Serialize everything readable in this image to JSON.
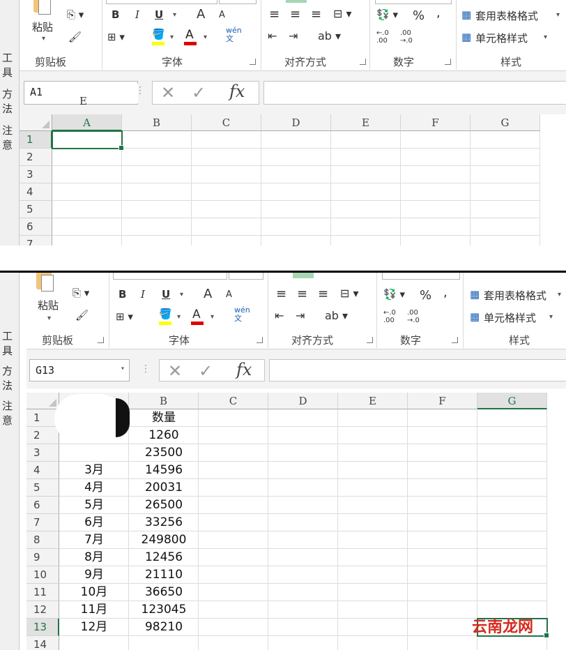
{
  "colors": {
    "accent": "#217346",
    "highlight_fill": "#ffff00",
    "font_color_bar": "#e00000",
    "watermark": "#d42b1e"
  },
  "left_strip_labels": [
    "工具",
    "方法",
    "注意"
  ],
  "ribbon": {
    "clipboard": {
      "paste_label": "粘贴",
      "group_label": "剪贴板",
      "icons": [
        "paste-icon",
        "copy-icon",
        "format-painter-icon"
      ]
    },
    "font": {
      "group_label": "字体",
      "bold": "B",
      "italic": "I",
      "underline": "U",
      "grow": "A",
      "shrink": "A",
      "phonetic": "wén\n文",
      "icons": [
        "border-icon",
        "fill-color-icon",
        "font-color-icon"
      ]
    },
    "alignment": {
      "group_label": "对齐方式",
      "icons": [
        "align-left-icon",
        "align-center-icon",
        "align-right-icon",
        "merge-icon",
        "indent-decrease-icon",
        "indent-increase-icon",
        "orientation-icon"
      ]
    },
    "number": {
      "group_label": "数字",
      "percent": "%",
      "comma": ",",
      "inc_decimal": "←.0\n.00",
      "dec_decimal": ".00\n→.0",
      "icons": [
        "accounting-icon"
      ]
    },
    "styles": {
      "group_label": "样式",
      "table_format": "套用表格格式",
      "cell_styles": "单元格样式"
    }
  },
  "top_panel": {
    "name_box": "A1",
    "formula_value": "",
    "tooltip_fragment": "E",
    "columns": [
      "A",
      "B",
      "C",
      "D",
      "E",
      "F",
      "G"
    ],
    "selected_column": "A",
    "rows": [
      "1",
      "2",
      "3",
      "4",
      "5",
      "6",
      "7"
    ],
    "selected_row": "1"
  },
  "bottom_panel": {
    "name_box": "G13",
    "formula_value": "",
    "columns": [
      "",
      "B",
      "C",
      "D",
      "E",
      "F",
      "G"
    ],
    "selected_column": "G",
    "rows": [
      "1",
      "2",
      "3",
      "4",
      "5",
      "6",
      "7",
      "8",
      "9",
      "10",
      "11",
      "12",
      "13",
      "14"
    ],
    "selected_row": "13",
    "header_b1": "数量",
    "table": [
      {
        "month": "",
        "qty": "1260"
      },
      {
        "month": "",
        "qty": "23500"
      },
      {
        "month": "3月",
        "qty": "14596"
      },
      {
        "month": "4月",
        "qty": "20031"
      },
      {
        "month": "5月",
        "qty": "26500"
      },
      {
        "month": "6月",
        "qty": "33256"
      },
      {
        "month": "7月",
        "qty": "249800"
      },
      {
        "month": "8月",
        "qty": "12456"
      },
      {
        "month": "9月",
        "qty": "21110"
      },
      {
        "month": "10月",
        "qty": "36650"
      },
      {
        "month": "11月",
        "qty": "123045"
      },
      {
        "month": "12月",
        "qty": "98210"
      }
    ],
    "watermark": "云南龙网"
  }
}
